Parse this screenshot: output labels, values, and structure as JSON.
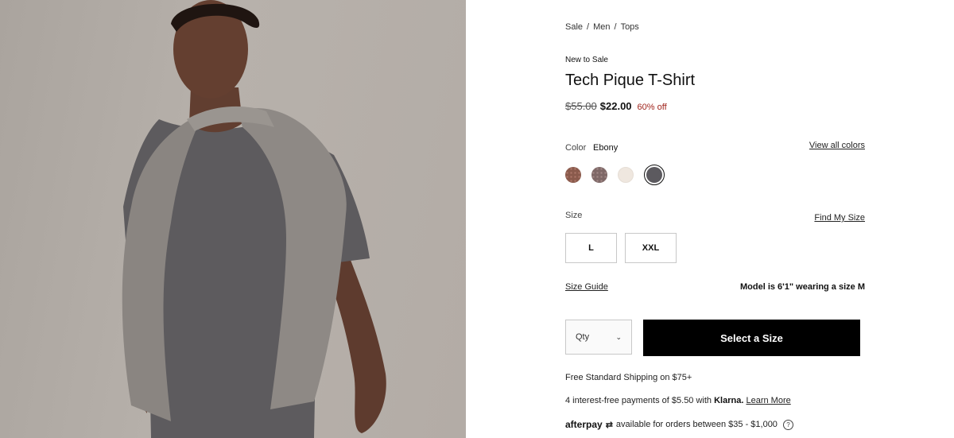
{
  "breadcrumb": {
    "items": [
      "Sale",
      "Men",
      "Tops"
    ],
    "separator": "/"
  },
  "product": {
    "badge": "New to Sale",
    "title": "Tech Pique T-Shirt",
    "price_original": "$55.00",
    "price_sale": "$22.00",
    "discount": "60% off"
  },
  "color": {
    "label": "Color",
    "selected": "Ebony",
    "view_all": "View all colors",
    "swatches": [
      {
        "name": "rust-pattern",
        "color": "#9d6b5e"
      },
      {
        "name": "mauve-pattern",
        "color": "#8f7776"
      },
      {
        "name": "cream",
        "color": "#efe7df"
      },
      {
        "name": "ebony",
        "color": "#5c5a5f",
        "selected": true
      }
    ]
  },
  "size": {
    "label": "Size",
    "find_my_size": "Find My Size",
    "options": [
      "L",
      "XXL"
    ],
    "size_guide": "Size Guide",
    "model_info": "Model is 6'1\" wearing a size M"
  },
  "purchase": {
    "qty_label": "Qty",
    "cta": "Select a Size"
  },
  "shipping": "Free Standard Shipping on $75+",
  "klarna": {
    "text": "4 interest-free payments of $5.50 with",
    "brand": "Klarna.",
    "link": "Learn More"
  },
  "afterpay": {
    "brand": "afterpay",
    "text": "available for orders between $35 - $1,000"
  }
}
